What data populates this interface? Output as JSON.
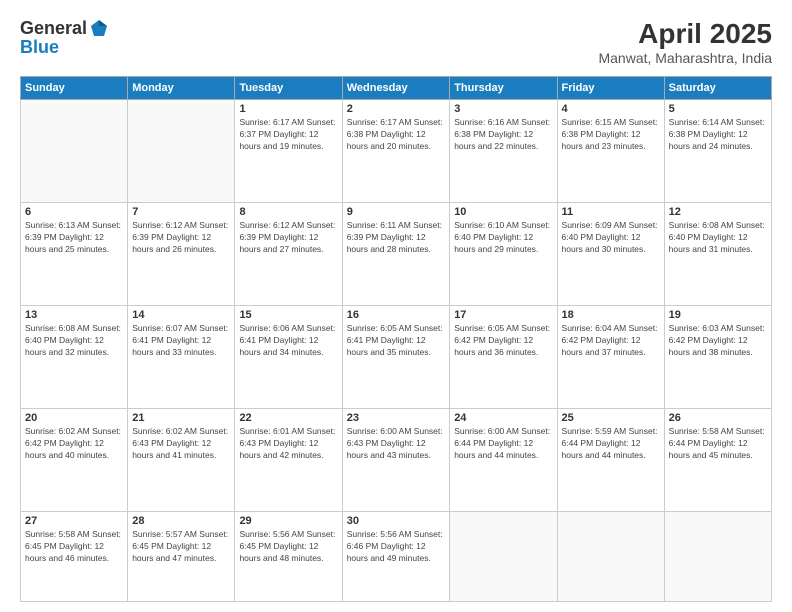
{
  "header": {
    "logo_general": "General",
    "logo_blue": "Blue",
    "title": "April 2025",
    "location": "Manwat, Maharashtra, India"
  },
  "days_of_week": [
    "Sunday",
    "Monday",
    "Tuesday",
    "Wednesday",
    "Thursday",
    "Friday",
    "Saturday"
  ],
  "weeks": [
    [
      {
        "day": "",
        "info": ""
      },
      {
        "day": "",
        "info": ""
      },
      {
        "day": "1",
        "info": "Sunrise: 6:17 AM\nSunset: 6:37 PM\nDaylight: 12 hours and 19 minutes."
      },
      {
        "day": "2",
        "info": "Sunrise: 6:17 AM\nSunset: 6:38 PM\nDaylight: 12 hours and 20 minutes."
      },
      {
        "day": "3",
        "info": "Sunrise: 6:16 AM\nSunset: 6:38 PM\nDaylight: 12 hours and 22 minutes."
      },
      {
        "day": "4",
        "info": "Sunrise: 6:15 AM\nSunset: 6:38 PM\nDaylight: 12 hours and 23 minutes."
      },
      {
        "day": "5",
        "info": "Sunrise: 6:14 AM\nSunset: 6:38 PM\nDaylight: 12 hours and 24 minutes."
      }
    ],
    [
      {
        "day": "6",
        "info": "Sunrise: 6:13 AM\nSunset: 6:39 PM\nDaylight: 12 hours and 25 minutes."
      },
      {
        "day": "7",
        "info": "Sunrise: 6:12 AM\nSunset: 6:39 PM\nDaylight: 12 hours and 26 minutes."
      },
      {
        "day": "8",
        "info": "Sunrise: 6:12 AM\nSunset: 6:39 PM\nDaylight: 12 hours and 27 minutes."
      },
      {
        "day": "9",
        "info": "Sunrise: 6:11 AM\nSunset: 6:39 PM\nDaylight: 12 hours and 28 minutes."
      },
      {
        "day": "10",
        "info": "Sunrise: 6:10 AM\nSunset: 6:40 PM\nDaylight: 12 hours and 29 minutes."
      },
      {
        "day": "11",
        "info": "Sunrise: 6:09 AM\nSunset: 6:40 PM\nDaylight: 12 hours and 30 minutes."
      },
      {
        "day": "12",
        "info": "Sunrise: 6:08 AM\nSunset: 6:40 PM\nDaylight: 12 hours and 31 minutes."
      }
    ],
    [
      {
        "day": "13",
        "info": "Sunrise: 6:08 AM\nSunset: 6:40 PM\nDaylight: 12 hours and 32 minutes."
      },
      {
        "day": "14",
        "info": "Sunrise: 6:07 AM\nSunset: 6:41 PM\nDaylight: 12 hours and 33 minutes."
      },
      {
        "day": "15",
        "info": "Sunrise: 6:06 AM\nSunset: 6:41 PM\nDaylight: 12 hours and 34 minutes."
      },
      {
        "day": "16",
        "info": "Sunrise: 6:05 AM\nSunset: 6:41 PM\nDaylight: 12 hours and 35 minutes."
      },
      {
        "day": "17",
        "info": "Sunrise: 6:05 AM\nSunset: 6:42 PM\nDaylight: 12 hours and 36 minutes."
      },
      {
        "day": "18",
        "info": "Sunrise: 6:04 AM\nSunset: 6:42 PM\nDaylight: 12 hours and 37 minutes."
      },
      {
        "day": "19",
        "info": "Sunrise: 6:03 AM\nSunset: 6:42 PM\nDaylight: 12 hours and 38 minutes."
      }
    ],
    [
      {
        "day": "20",
        "info": "Sunrise: 6:02 AM\nSunset: 6:42 PM\nDaylight: 12 hours and 40 minutes."
      },
      {
        "day": "21",
        "info": "Sunrise: 6:02 AM\nSunset: 6:43 PM\nDaylight: 12 hours and 41 minutes."
      },
      {
        "day": "22",
        "info": "Sunrise: 6:01 AM\nSunset: 6:43 PM\nDaylight: 12 hours and 42 minutes."
      },
      {
        "day": "23",
        "info": "Sunrise: 6:00 AM\nSunset: 6:43 PM\nDaylight: 12 hours and 43 minutes."
      },
      {
        "day": "24",
        "info": "Sunrise: 6:00 AM\nSunset: 6:44 PM\nDaylight: 12 hours and 44 minutes."
      },
      {
        "day": "25",
        "info": "Sunrise: 5:59 AM\nSunset: 6:44 PM\nDaylight: 12 hours and 44 minutes."
      },
      {
        "day": "26",
        "info": "Sunrise: 5:58 AM\nSunset: 6:44 PM\nDaylight: 12 hours and 45 minutes."
      }
    ],
    [
      {
        "day": "27",
        "info": "Sunrise: 5:58 AM\nSunset: 6:45 PM\nDaylight: 12 hours and 46 minutes."
      },
      {
        "day": "28",
        "info": "Sunrise: 5:57 AM\nSunset: 6:45 PM\nDaylight: 12 hours and 47 minutes."
      },
      {
        "day": "29",
        "info": "Sunrise: 5:56 AM\nSunset: 6:45 PM\nDaylight: 12 hours and 48 minutes."
      },
      {
        "day": "30",
        "info": "Sunrise: 5:56 AM\nSunset: 6:46 PM\nDaylight: 12 hours and 49 minutes."
      },
      {
        "day": "",
        "info": ""
      },
      {
        "day": "",
        "info": ""
      },
      {
        "day": "",
        "info": ""
      }
    ]
  ]
}
